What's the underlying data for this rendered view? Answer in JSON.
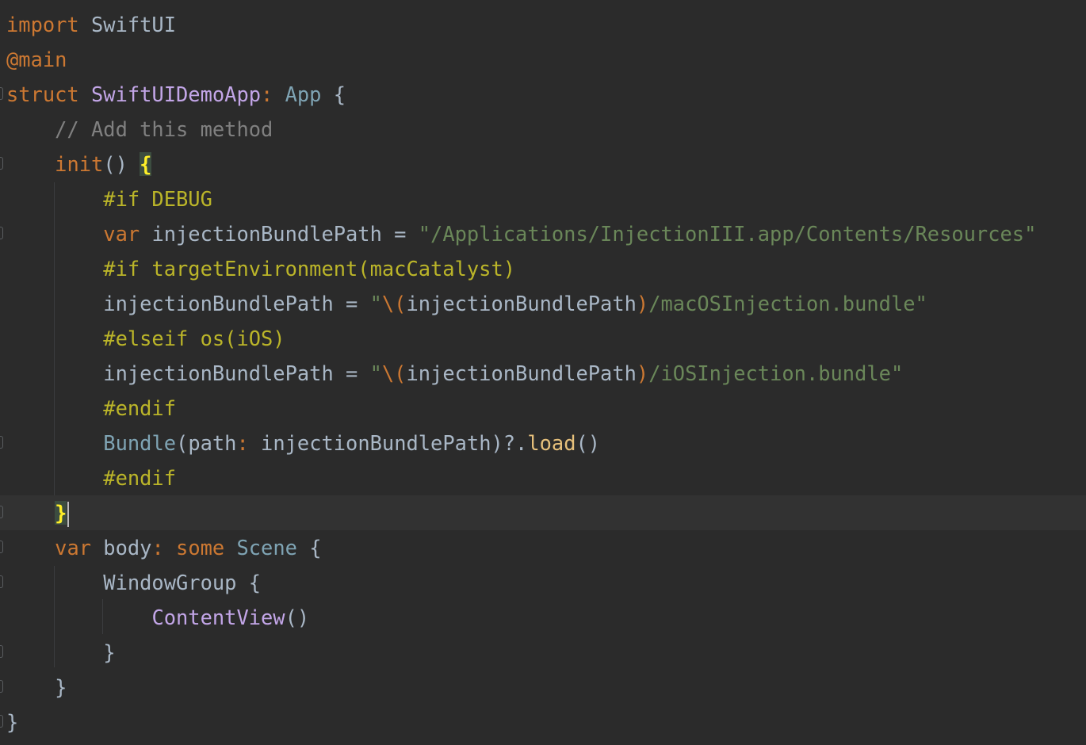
{
  "colors": {
    "background": "#2b2b2b",
    "current_line": "#323232",
    "keyword": "#cc7832",
    "directive": "#bbb529",
    "string": "#6a8759",
    "comment": "#808080",
    "type": "#a9b7c6",
    "default": "#a9b7c6",
    "user_type": "#c3a6e8",
    "system_type": "#7fa4b4",
    "brace_match": "#ffef28"
  },
  "editor": {
    "lines": [
      {
        "tokens": [
          {
            "t": "import",
            "c": "#cc7832"
          },
          {
            "t": " SwiftUI",
            "c": "#a9b7c6"
          }
        ],
        "fold": false
      },
      {
        "tokens": [
          {
            "t": "@main",
            "c": "#cc7832"
          }
        ],
        "fold": false
      },
      {
        "tokens": [
          {
            "t": "struct",
            "c": "#cc7832"
          },
          {
            "t": " ",
            "c": "#a9b7c6"
          },
          {
            "t": "SwiftUIDemoApp",
            "c": "#c3a6e8"
          },
          {
            "t": ": ",
            "c": "#cc7832"
          },
          {
            "t": "App",
            "c": "#7fa4b4"
          },
          {
            "t": " {",
            "c": "#a9b7c6"
          }
        ],
        "fold": true
      },
      {
        "tokens": [
          {
            "t": "    // Add this method",
            "c": "#808080"
          }
        ],
        "fold": false
      },
      {
        "tokens": [
          {
            "t": "    ",
            "c": "#a9b7c6"
          },
          {
            "t": "init",
            "c": "#cc7832"
          },
          {
            "t": "() ",
            "c": "#a9b7c6"
          },
          {
            "t": "{",
            "c": "#ffef28",
            "hl": true
          }
        ],
        "fold": true
      },
      {
        "tokens": [
          {
            "t": "        #if DEBUG",
            "c": "#bbb529"
          }
        ],
        "fold": false
      },
      {
        "tokens": [
          {
            "t": "        ",
            "c": "#a9b7c6"
          },
          {
            "t": "var",
            "c": "#cc7832"
          },
          {
            "t": " injectionBundlePath = ",
            "c": "#a9b7c6"
          },
          {
            "t": "\"/Applications/InjectionIII.app/Contents/Resources\"",
            "c": "#6a8759"
          }
        ],
        "fold": true
      },
      {
        "tokens": [
          {
            "t": "        #if targetEnvironment(macCatalyst)",
            "c": "#bbb529"
          }
        ],
        "fold": false
      },
      {
        "tokens": [
          {
            "t": "        injectionBundlePath = ",
            "c": "#a9b7c6"
          },
          {
            "t": "\"",
            "c": "#6a8759"
          },
          {
            "t": "\\(",
            "c": "#cc7832"
          },
          {
            "t": "injectionBundlePath",
            "c": "#a9b7c6"
          },
          {
            "t": ")",
            "c": "#cc7832"
          },
          {
            "t": "/macOSInjection.bundle\"",
            "c": "#6a8759"
          }
        ],
        "fold": false
      },
      {
        "tokens": [
          {
            "t": "        #elseif os(iOS)",
            "c": "#bbb529"
          }
        ],
        "fold": false
      },
      {
        "tokens": [
          {
            "t": "        injectionBundlePath = ",
            "c": "#a9b7c6"
          },
          {
            "t": "\"",
            "c": "#6a8759"
          },
          {
            "t": "\\(",
            "c": "#cc7832"
          },
          {
            "t": "injectionBundlePath",
            "c": "#a9b7c6"
          },
          {
            "t": ")",
            "c": "#cc7832"
          },
          {
            "t": "/iOSInjection.bundle\"",
            "c": "#6a8759"
          }
        ],
        "fold": false
      },
      {
        "tokens": [
          {
            "t": "        #endif",
            "c": "#bbb529"
          }
        ],
        "fold": false
      },
      {
        "tokens": [
          {
            "t": "        ",
            "c": "#a9b7c6"
          },
          {
            "t": "Bundle",
            "c": "#7fa4b4"
          },
          {
            "t": "(",
            "c": "#a9b7c6"
          },
          {
            "t": "path",
            "c": "#a9b7c6"
          },
          {
            "t": ": ",
            "c": "#cc7832"
          },
          {
            "t": "injectionBundlePath)?.",
            "c": "#a9b7c6"
          },
          {
            "t": "load",
            "c": "#e6c07b"
          },
          {
            "t": "()",
            "c": "#a9b7c6"
          }
        ],
        "fold": true
      },
      {
        "tokens": [
          {
            "t": "        #endif",
            "c": "#bbb529"
          }
        ],
        "fold": false
      },
      {
        "tokens": [
          {
            "t": "    ",
            "c": "#a9b7c6"
          },
          {
            "t": "}",
            "c": "#ffef28",
            "hl": true
          }
        ],
        "fold": true,
        "current": true,
        "caret": true
      },
      {
        "tokens": [
          {
            "t": "    ",
            "c": "#a9b7c6"
          },
          {
            "t": "var",
            "c": "#cc7832"
          },
          {
            "t": " body",
            "c": "#a9b7c6"
          },
          {
            "t": ": ",
            "c": "#cc7832"
          },
          {
            "t": "some",
            "c": "#cc7832"
          },
          {
            "t": " ",
            "c": "#a9b7c6"
          },
          {
            "t": "Scene",
            "c": "#7fa4b4"
          },
          {
            "t": " {",
            "c": "#a9b7c6"
          }
        ],
        "fold": true
      },
      {
        "tokens": [
          {
            "t": "        WindowGroup {",
            "c": "#a9b7c6"
          }
        ],
        "fold": true
      },
      {
        "tokens": [
          {
            "t": "            ",
            "c": "#a9b7c6"
          },
          {
            "t": "ContentView",
            "c": "#c3a6e8"
          },
          {
            "t": "()",
            "c": "#a9b7c6"
          }
        ],
        "fold": false
      },
      {
        "tokens": [
          {
            "t": "        }",
            "c": "#a9b7c6"
          }
        ],
        "fold": true
      },
      {
        "tokens": [
          {
            "t": "    }",
            "c": "#a9b7c6"
          }
        ],
        "fold": true
      },
      {
        "tokens": [
          {
            "t": "}",
            "c": "#a9b7c6"
          }
        ],
        "fold": true
      }
    ]
  }
}
